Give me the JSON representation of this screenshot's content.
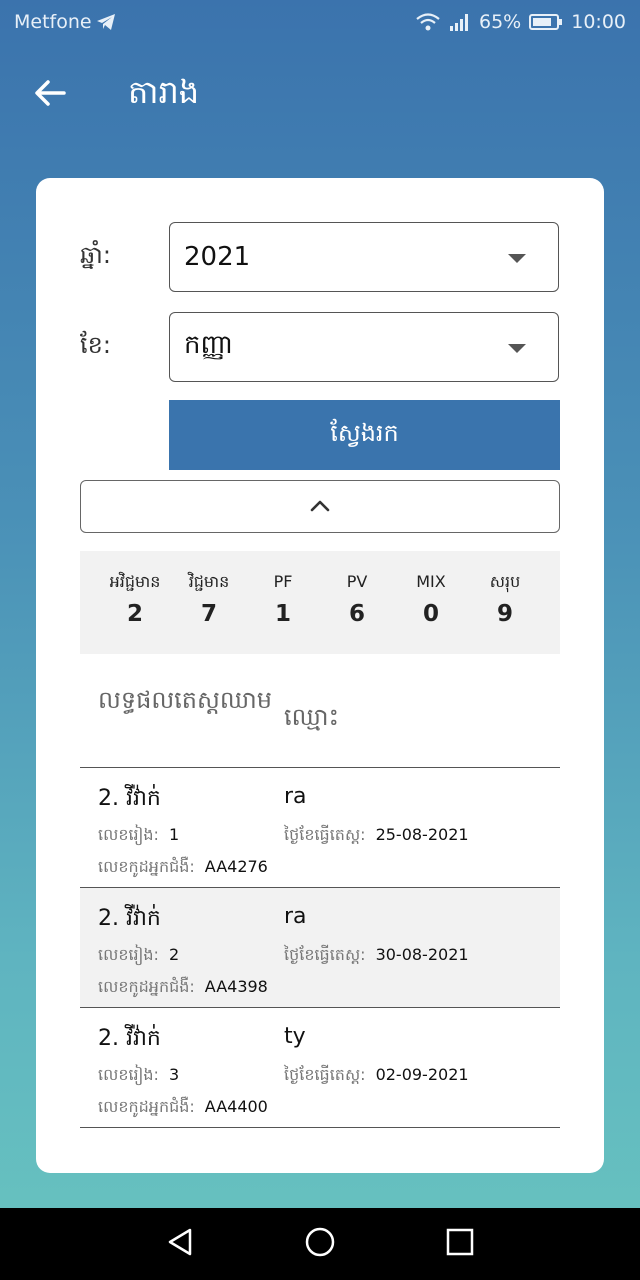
{
  "status_bar": {
    "carrier": "Metfone",
    "battery": "65%",
    "time": "10:00"
  },
  "header": {
    "title": "តារាង"
  },
  "filters": {
    "year_label": "ឆ្នាំ:",
    "year_value": "2021",
    "month_label": "ខែ:",
    "month_value": "កញ្ញា",
    "search_label": "ស្វែងរក"
  },
  "summary": [
    {
      "label": "អវិជ្ជមាន",
      "value": "2"
    },
    {
      "label": "វិជ្ជមាន",
      "value": "7"
    },
    {
      "label": "PF",
      "value": "1"
    },
    {
      "label": "PV",
      "value": "6"
    },
    {
      "label": "MIX",
      "value": "0"
    },
    {
      "label": "សរុប",
      "value": "9"
    }
  ],
  "table": {
    "col_result": "លទ្ធផលតេស្តឈាម",
    "col_name": "ឈ្មោះ",
    "labels": {
      "order": "លេខរៀង:",
      "test_date": "ថ្ងៃខែធ្វើតេស្ត:",
      "patient_code": "លេខកូដអ្នកជំងឺ:"
    },
    "rows": [
      {
        "result": "2. វីវ៉ាក់",
        "name": "ra",
        "order": "1",
        "test_date": "25-08-2021",
        "patient_code": "AA4276"
      },
      {
        "result": "2. វីវ៉ាក់",
        "name": "ra",
        "order": "2",
        "test_date": "30-08-2021",
        "patient_code": "AA4398"
      },
      {
        "result": "2. វីវ៉ាក់",
        "name": "ty",
        "order": "3",
        "test_date": "02-09-2021",
        "patient_code": "AA4400"
      }
    ]
  }
}
